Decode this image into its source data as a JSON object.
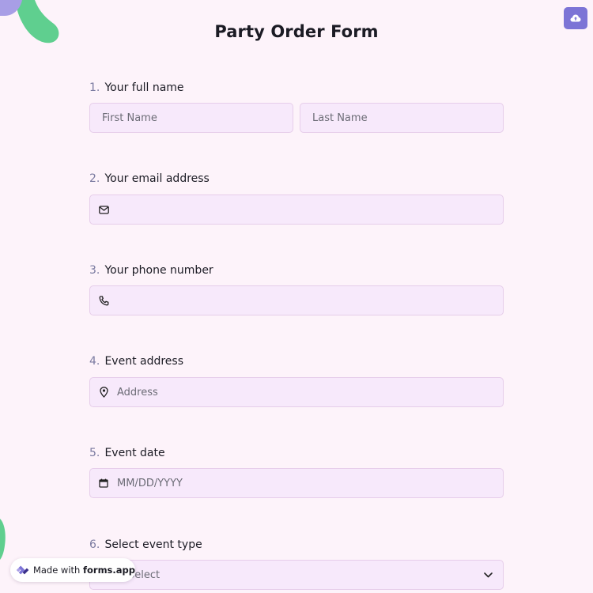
{
  "form": {
    "title": "Party Order Form",
    "colors": {
      "background": "#fdf3fa",
      "field_bg": "#f7e9fb",
      "field_border": "#e6cdea",
      "accent": "#7c74d6",
      "blob_green": "#5fcf8f",
      "blob_purple": "#a89ee6"
    }
  },
  "toolbar": {
    "save_icon": "cloud-upload-icon"
  },
  "questions": {
    "q1": {
      "number": "1.",
      "label": "Your full name",
      "first_placeholder": "First Name",
      "last_placeholder": "Last Name"
    },
    "q2": {
      "number": "2.",
      "label": "Your email address",
      "icon": "envelope-icon",
      "placeholder": ""
    },
    "q3": {
      "number": "3.",
      "label": "Your phone number",
      "icon": "phone-icon",
      "placeholder": ""
    },
    "q4": {
      "number": "4.",
      "label": "Event address",
      "icon": "map-pin-icon",
      "placeholder": "Address"
    },
    "q5": {
      "number": "5.",
      "label": "Event date",
      "icon": "calendar-icon",
      "placeholder": "MM/DD/YYYY"
    },
    "q6": {
      "number": "6.",
      "label": "Select event type",
      "selected": "Select",
      "icon": "chevron-down-icon"
    }
  },
  "badge": {
    "prefix": "Made with",
    "brand": "forms.app",
    "icon": "forms-app-logo-icon"
  }
}
